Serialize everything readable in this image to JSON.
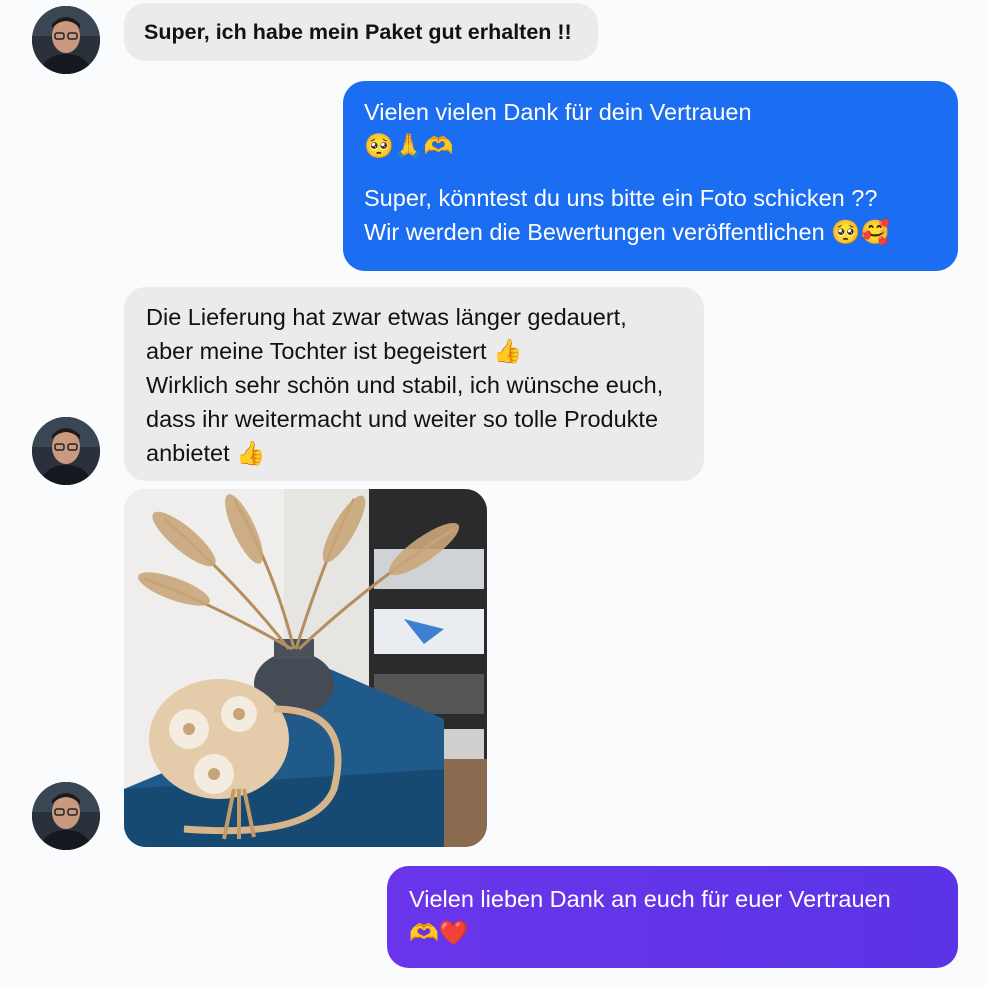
{
  "thread": {
    "messages": [
      {
        "sender": "contact",
        "lines": [
          "Super, ich habe mein Paket gut erhalten !!"
        ]
      },
      {
        "sender": "me",
        "lines": [
          "Vielen vielen Dank für dein Vertrauen",
          "🥺🙏🫶"
        ]
      },
      {
        "sender": "me",
        "lines": [
          "Super, könntest du uns bitte ein Foto schicken ??",
          "Wir werden die Bewertungen veröffentlichen 🥺🥰"
        ]
      },
      {
        "sender": "contact",
        "lines": [
          "Die Lieferung hat zwar etwas länger gedauert,",
          "aber meine Tochter ist begeistert 👍",
          "Wirklich sehr schön und stabil, ich wünsche euch,",
          "dass ihr weitermacht und weiter so tolle Produkte",
          "anbietet 👍"
        ]
      },
      {
        "sender": "me",
        "lines": [
          "Vielen lieben Dank an euch für euer Vertrauen",
          "🫶❤️"
        ]
      }
    ]
  },
  "colors": {
    "incoming_bubble": "#ebebed",
    "outgoing_bubble": "#1b6ef2",
    "outgoing_bubble_alt": "#5f35e8",
    "background": "#fafbfd"
  },
  "icons": {
    "avatar": "contact-avatar",
    "photo": "photo-attachment"
  }
}
